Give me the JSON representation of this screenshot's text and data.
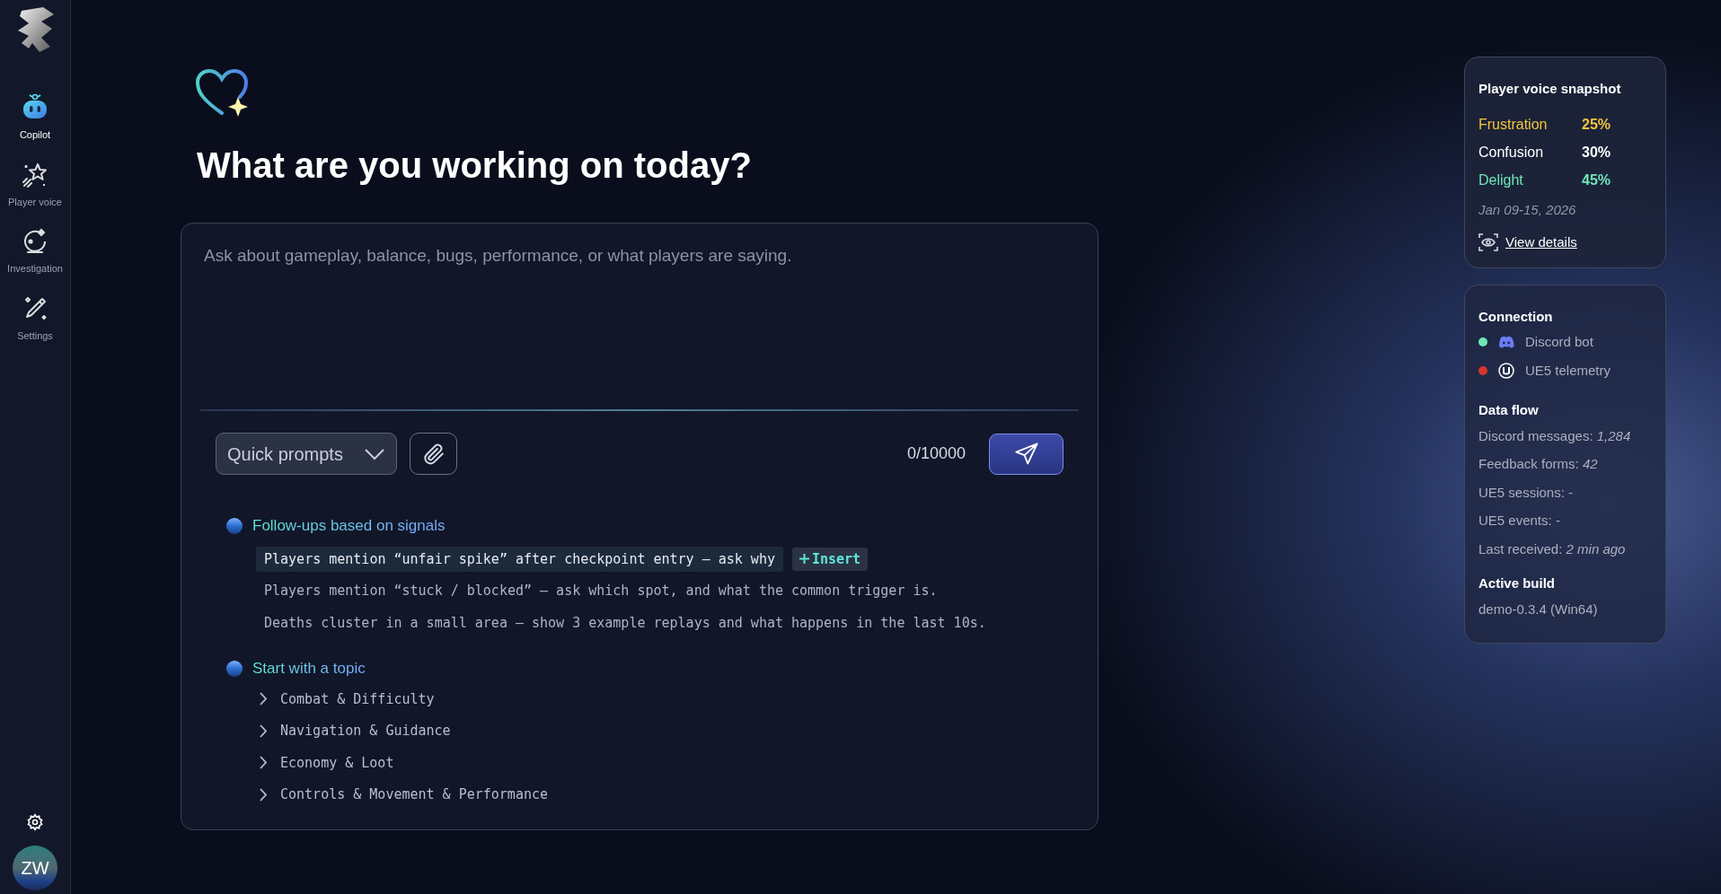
{
  "sidebar": {
    "items": [
      {
        "label": "Copilot",
        "kind": "robot",
        "selected": true
      },
      {
        "label": "Player voice",
        "kind": "stars",
        "selected": false
      },
      {
        "label": "Investigation",
        "kind": "orb",
        "selected": false
      },
      {
        "label": "Settings",
        "kind": "pen",
        "selected": false
      }
    ],
    "avatar": "ZW"
  },
  "heading": "What are you working on today?",
  "composer": {
    "placeholder": "Ask about gameplay, balance, bugs, performance, or what players are saying.",
    "quick_prompts": "Quick prompts",
    "counter": "0/10000"
  },
  "followups": {
    "title": "Follow-ups based on signals",
    "items": [
      {
        "text": "Players mention “unfair spike” after checkpoint entry — ask why",
        "selected": true,
        "action": "Insert"
      },
      {
        "text": "Players mention “stuck / blocked” — ask which spot, and what the common trigger is.",
        "selected": false
      },
      {
        "text": "Deaths cluster in a small area — show 3 example replays and what happens in the last 10s.",
        "selected": false
      }
    ]
  },
  "topics": {
    "title": "Start with a topic",
    "items": [
      {
        "label": "Combat & Difficulty",
        "expanded": false
      },
      {
        "label": "Navigation & Guidance",
        "expanded": false
      },
      {
        "label": "Economy & Loot",
        "expanded": false
      },
      {
        "label": "Controls & Movement & Performance",
        "expanded": false
      }
    ]
  },
  "snapshot": {
    "title": "Player voice snapshot",
    "rows": [
      {
        "label": "Frustration",
        "value": "25%",
        "color": "#f5c43c"
      },
      {
        "label": "Confusion",
        "value": "30%",
        "color": "#ffffff"
      },
      {
        "label": "Delight",
        "value": "45%",
        "color": "#6ee7b7"
      }
    ],
    "date": "Jan 09-15, 2026",
    "link": "View details"
  },
  "connection": {
    "title": "Connection",
    "items": [
      {
        "label": "Discord bot",
        "kind": "discord",
        "color": "#6ee7b7"
      },
      {
        "label": "UE5 telemetry",
        "kind": "unreal",
        "color": "#d9342b"
      }
    ]
  },
  "data_flow": {
    "title": "Data flow",
    "lines": [
      "Discord messages: *1,284*",
      "Feedback forms: *42*",
      "UE5 sessions: -",
      "UE5 events: -",
      "Last received: *2 min ago*"
    ]
  },
  "active_build": {
    "title": "Active build",
    "value": "demo-0.3.4 (Win64)"
  }
}
